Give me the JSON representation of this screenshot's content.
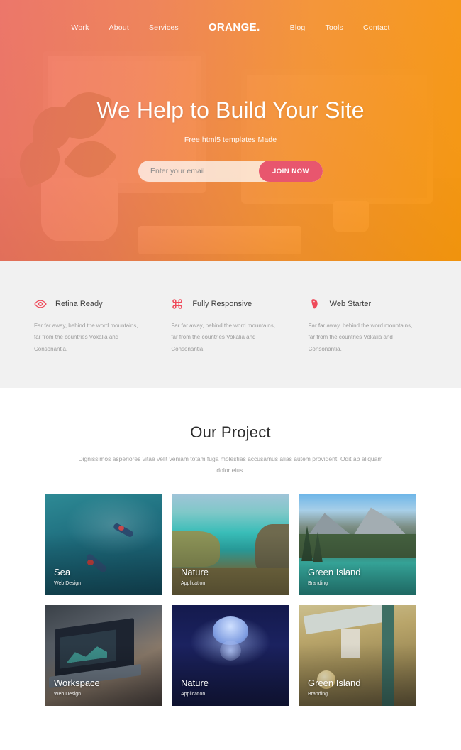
{
  "nav": {
    "brand": "ORANGE.",
    "left_links": [
      {
        "label": "Work"
      },
      {
        "label": "About"
      },
      {
        "label": "Services"
      }
    ],
    "right_links": [
      {
        "label": "Blog"
      },
      {
        "label": "Tools"
      },
      {
        "label": "Contact"
      }
    ]
  },
  "hero": {
    "title": "We Help to Build Your Site",
    "subtitle": "Free html5 templates Made",
    "email_placeholder": "Enter your email",
    "email_value": "",
    "cta_label": "JOIN NOW",
    "gradient_from": "#f06c60",
    "gradient_to": "#fa9707",
    "cta_color": "#e8566e"
  },
  "features": {
    "accent_color": "#ef4a5a",
    "background": "#f1f1f1",
    "items": [
      {
        "icon": "eye-icon",
        "title": "Retina Ready",
        "text": "Far far away, behind the word mountains, far from the countries Vokalia and Consonantia."
      },
      {
        "icon": "command-icon",
        "title": "Fully Responsive",
        "text": "Far far away, behind the word mountains, far from the countries Vokalia and Consonantia."
      },
      {
        "icon": "mouse-icon",
        "title": "Web Starter",
        "text": "Far far away, behind the word mountains, far from the countries Vokalia and Consonantia."
      }
    ]
  },
  "projects": {
    "title": "Our Project",
    "subtitle": "Dignissimos asperiores vitae velit veniam totam fuga molestias accusamus alias autem provident. Odit ab aliquam dolor eius.",
    "cards": [
      {
        "name": "Sea",
        "category": "Web Design",
        "image": "aerial-ocean-surfers"
      },
      {
        "name": "Nature",
        "category": "Application",
        "image": "turquoise-coastline"
      },
      {
        "name": "Green Island",
        "category": "Branding",
        "image": "mountain-lake"
      },
      {
        "name": "Workspace",
        "category": "Web Design",
        "image": "laptop-desk"
      },
      {
        "name": "Nature",
        "category": "Application",
        "image": "jellyfish-deep-blue"
      },
      {
        "name": "Green Island",
        "category": "Branding",
        "image": "street-sign-lamps"
      }
    ]
  }
}
